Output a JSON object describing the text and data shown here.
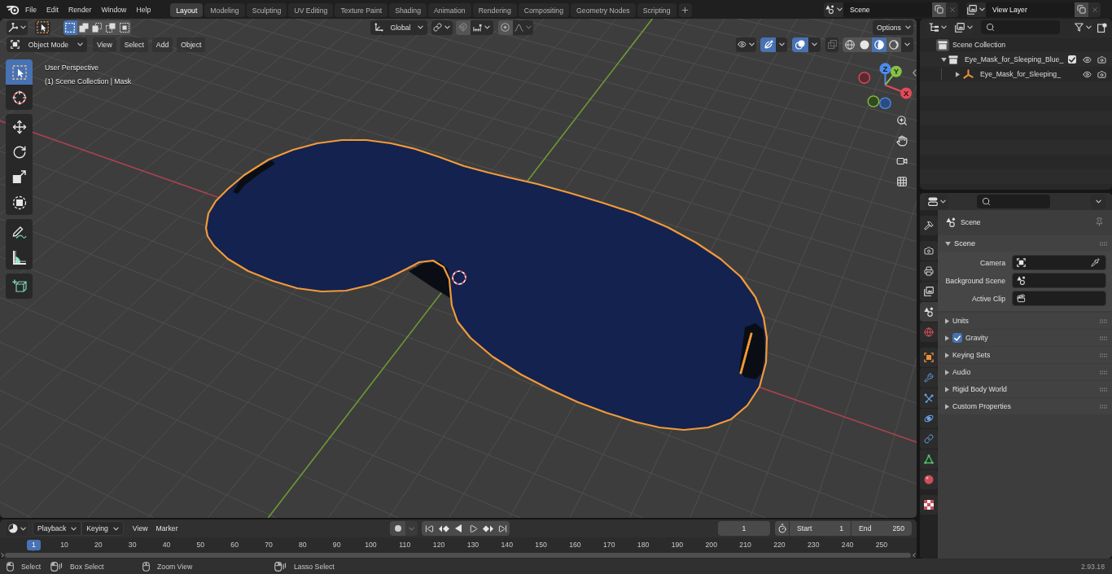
{
  "top_bar": {
    "menus": [
      "File",
      "Edit",
      "Render",
      "Window",
      "Help"
    ],
    "workspaces": [
      {
        "label": "Layout",
        "selected": true
      },
      {
        "label": "Modeling",
        "selected": false
      },
      {
        "label": "Sculpting",
        "selected": false
      },
      {
        "label": "UV Editing",
        "selected": false
      },
      {
        "label": "Texture Paint",
        "selected": false
      },
      {
        "label": "Shading",
        "selected": false
      },
      {
        "label": "Animation",
        "selected": false
      },
      {
        "label": "Rendering",
        "selected": false
      },
      {
        "label": "Compositing",
        "selected": false
      },
      {
        "label": "Geometry Nodes",
        "selected": false
      },
      {
        "label": "Scripting",
        "selected": false
      }
    ],
    "scene": "Scene",
    "view_layer": "View Layer"
  },
  "tool_header": {
    "select_modes": [
      {
        "selected": true
      },
      {
        "selected": false
      },
      {
        "selected": false
      },
      {
        "selected": false
      },
      {
        "selected": false
      }
    ],
    "orientation": "Global",
    "snap": false,
    "proportional_editing": false,
    "options": "Options"
  },
  "viewport_header": {
    "mode": "Object Mode",
    "menus": [
      "View",
      "Select",
      "Add",
      "Object"
    ],
    "gizmos": true,
    "overlays": true,
    "xray": false,
    "shading": [
      {
        "selected": false
      },
      {
        "selected": false
      },
      {
        "selected": true
      },
      {
        "selected": false
      }
    ]
  },
  "toolbar": [
    {
      "selected": true
    },
    {
      "selected": false
    },
    {
      "selected": false
    },
    {
      "selected": false
    },
    {
      "selected": false
    },
    {
      "selected": false
    },
    {
      "selected": false
    },
    {
      "selected": false
    },
    {
      "selected": false
    }
  ],
  "viewport": {
    "view_name": "User Perspective",
    "collection_info": "(1) Scene Collection | Mask",
    "gizmo_axes": [
      "Z",
      "Y",
      "X"
    ]
  },
  "outliner": {
    "root": "Scene Collection",
    "items": [
      {
        "label": "Eye_Mask_for_Sleeping_Blue_",
        "kind": "collection",
        "expanded": true,
        "checked": true,
        "children": [
          {
            "label": "Eye_Mask_for_Sleeping_",
            "kind": "object",
            "expanded": false
          }
        ]
      }
    ]
  },
  "properties": {
    "tabs": [
      {
        "selected": false
      },
      {
        "selected": false
      },
      {
        "selected": false
      },
      {
        "selected": false
      },
      {
        "selected": true
      },
      {
        "selected": false
      },
      {
        "selected": false
      },
      {
        "selected": false
      },
      {
        "selected": false
      },
      {
        "selected": false
      },
      {
        "selected": false
      },
      {
        "selected": false
      },
      {
        "selected": false
      },
      {
        "selected": false
      }
    ],
    "context": "Scene",
    "panel": {
      "title": "Scene",
      "expanded": true,
      "fields": [
        {
          "label": "Camera"
        },
        {
          "label": "Background Scene"
        },
        {
          "label": "Active Clip"
        }
      ]
    },
    "subpanels": [
      {
        "label": "Units",
        "kind": "plain",
        "expanded": false
      },
      {
        "label": "Gravity",
        "kind": "toggle",
        "expanded": false,
        "checked": true
      },
      {
        "label": "Keying Sets",
        "kind": "plain",
        "expanded": false
      },
      {
        "label": "Audio",
        "kind": "plain",
        "expanded": false
      },
      {
        "label": "Rigid Body World",
        "kind": "plain",
        "expanded": false
      },
      {
        "label": "Custom Properties",
        "kind": "plain",
        "expanded": false
      }
    ]
  },
  "timeline": {
    "menus": [
      {
        "label": "Playback",
        "kind": "dropdown"
      },
      {
        "label": "Keying",
        "kind": "dropdown"
      },
      {
        "label": "View",
        "kind": "menu"
      },
      {
        "label": "Marker",
        "kind": "menu"
      }
    ],
    "auto_keying": false,
    "current_frame": "1",
    "start": {
      "label": "Start",
      "value": "1"
    },
    "end": {
      "label": "End",
      "value": "250"
    },
    "ruler": {
      "current": "1",
      "labels": [
        "10",
        "20",
        "30",
        "40",
        "50",
        "60",
        "70",
        "80",
        "90",
        "100",
        "110",
        "120",
        "130",
        "140",
        "150",
        "160",
        "170",
        "180",
        "190",
        "200",
        "210",
        "220",
        "230",
        "240",
        "250"
      ]
    }
  },
  "status_bar": {
    "hints": [
      "Select",
      "Box Select",
      "Zoom View",
      "Lasso Select"
    ],
    "version": "2.93.18"
  }
}
